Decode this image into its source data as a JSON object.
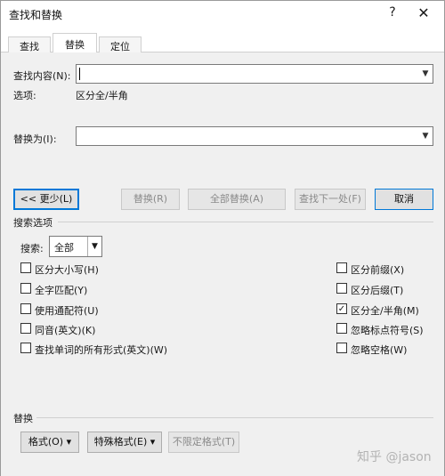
{
  "window": {
    "title": "查找和替换",
    "help_label": "?",
    "close_label": "✕"
  },
  "tabs": [
    {
      "label": "查找(D)",
      "active": false
    },
    {
      "label": "替换(P)",
      "active": true
    },
    {
      "label": "定位(G)",
      "active": false
    }
  ],
  "find": {
    "label": "查找内容(N):",
    "value": "",
    "options_label": "选项:",
    "options_value": "区分全/半角"
  },
  "replace": {
    "label": "替换为(I):",
    "value": ""
  },
  "buttons": {
    "less": "<< 更少(L)",
    "replace": "替换(R)",
    "replace_all": "全部替换(A)",
    "find_next": "查找下一处(F)",
    "cancel": "取消"
  },
  "search_options": {
    "group_title": "搜索选项",
    "search_label": "搜索:",
    "search_value": "全部",
    "left_checks": [
      {
        "label": "区分大小写(H)",
        "checked": false
      },
      {
        "label": "全字匹配(Y)",
        "checked": false
      },
      {
        "label": "使用通配符(U)",
        "checked": false
      },
      {
        "label": "同音(英文)(K)",
        "checked": false
      },
      {
        "label": "查找单词的所有形式(英文)(W)",
        "checked": false
      }
    ],
    "right_checks": [
      {
        "label": "区分前缀(X)",
        "checked": false
      },
      {
        "label": "区分后缀(T)",
        "checked": false
      },
      {
        "label": "区分全/半角(M)",
        "checked": true
      },
      {
        "label": "忽略标点符号(S)",
        "checked": false
      },
      {
        "label": "忽略空格(W)",
        "checked": false
      }
    ]
  },
  "replace_section": {
    "group_title": "替换",
    "format_button": "格式(O) ▾",
    "special_button": "特殊格式(E) ▾",
    "no_format_button": "不限定格式(T)"
  },
  "watermark": "知乎 @jason",
  "icons": {
    "dropdown": "chevron-down-icon",
    "checkmark": "check-icon"
  }
}
